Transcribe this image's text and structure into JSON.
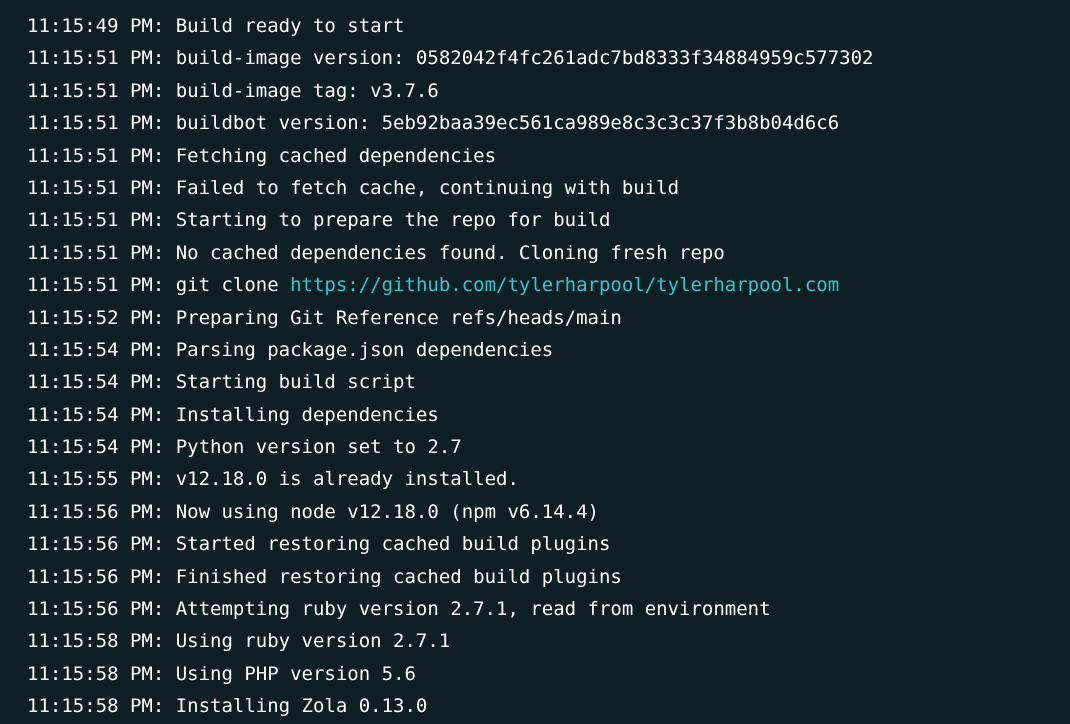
{
  "log": {
    "lines": [
      {
        "time": "11:15:49 PM: ",
        "message": "Build ready to start"
      },
      {
        "time": "11:15:51 PM: ",
        "message": "build-image version: 0582042f4fc261adc7bd8333f34884959c577302"
      },
      {
        "time": "11:15:51 PM: ",
        "message": "build-image tag: v3.7.6"
      },
      {
        "time": "11:15:51 PM: ",
        "message": "buildbot version: 5eb92baa39ec561ca989e8c3c3c37f3b8b04d6c6"
      },
      {
        "time": "11:15:51 PM: ",
        "message": "Fetching cached dependencies"
      },
      {
        "time": "11:15:51 PM: ",
        "message": "Failed to fetch cache, continuing with build"
      },
      {
        "time": "11:15:51 PM: ",
        "message": "Starting to prepare the repo for build"
      },
      {
        "time": "11:15:51 PM: ",
        "message": "No cached dependencies found. Cloning fresh repo"
      },
      {
        "time": "11:15:51 PM: ",
        "message": "git clone ",
        "link": "https://github.com/tylerharpool/tylerharpool.com"
      },
      {
        "time": "11:15:52 PM: ",
        "message": "Preparing Git Reference refs/heads/main"
      },
      {
        "time": "11:15:54 PM: ",
        "message": "Parsing package.json dependencies"
      },
      {
        "time": "11:15:54 PM: ",
        "message": "Starting build script"
      },
      {
        "time": "11:15:54 PM: ",
        "message": "Installing dependencies"
      },
      {
        "time": "11:15:54 PM: ",
        "message": "Python version set to 2.7"
      },
      {
        "time": "11:15:55 PM: ",
        "message": "v12.18.0 is already installed."
      },
      {
        "time": "11:15:56 PM: ",
        "message": "Now using node v12.18.0 (npm v6.14.4)"
      },
      {
        "time": "11:15:56 PM: ",
        "message": "Started restoring cached build plugins"
      },
      {
        "time": "11:15:56 PM: ",
        "message": "Finished restoring cached build plugins"
      },
      {
        "time": "11:15:56 PM: ",
        "message": "Attempting ruby version 2.7.1, read from environment"
      },
      {
        "time": "11:15:58 PM: ",
        "message": "Using ruby version 2.7.1"
      },
      {
        "time": "11:15:58 PM: ",
        "message": "Using PHP version 5.6"
      },
      {
        "time": "11:15:58 PM: ",
        "message": "Installing Zola 0.13.0"
      }
    ]
  },
  "colors": {
    "background": "#0e1e25",
    "text": "#ffffff",
    "link": "#30c8c9"
  }
}
